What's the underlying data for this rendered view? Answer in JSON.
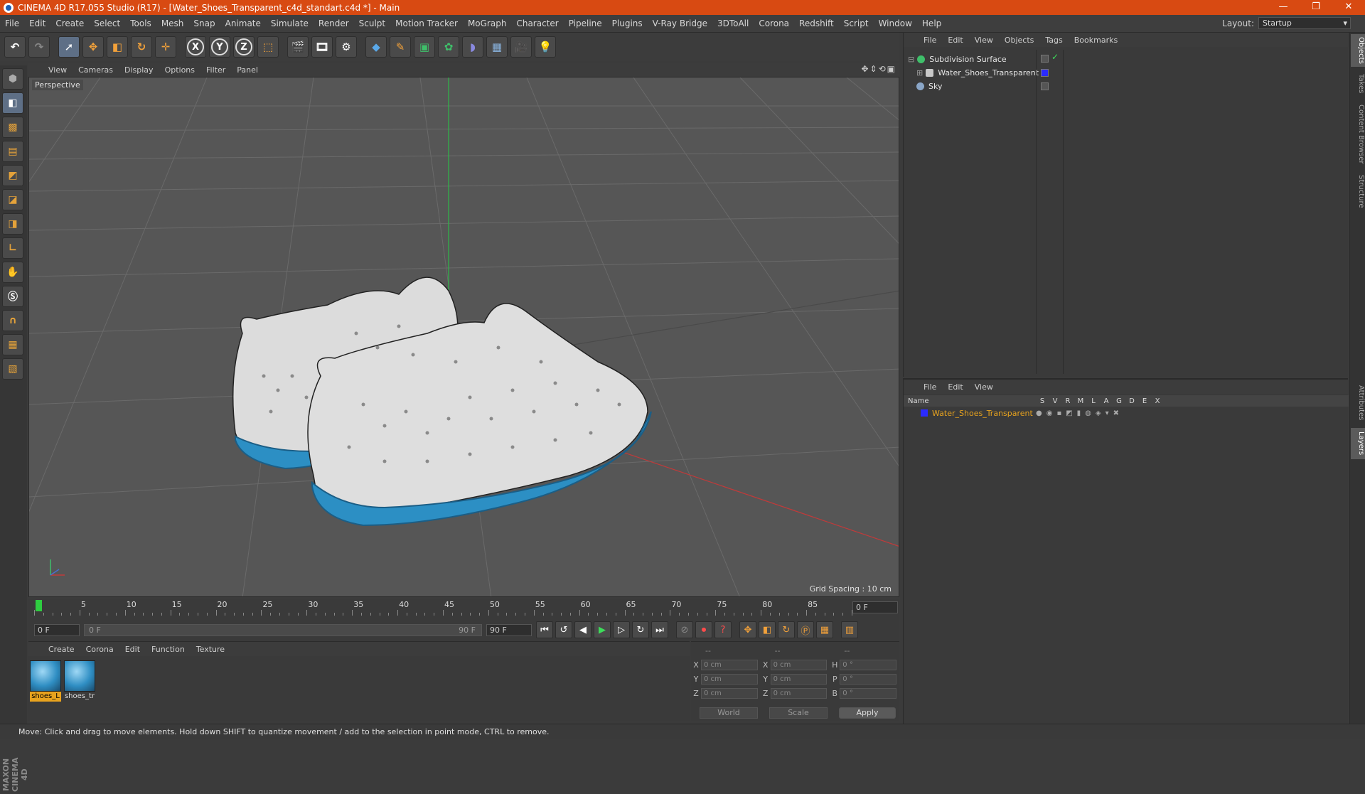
{
  "window": {
    "title": "CINEMA 4D R17.055 Studio (R17) - [Water_Shoes_Transparent_c4d_standart.c4d *] - Main",
    "minimize": "—",
    "restore": "❐",
    "close": "✕"
  },
  "menu": [
    "File",
    "Edit",
    "Create",
    "Select",
    "Tools",
    "Mesh",
    "Snap",
    "Animate",
    "Simulate",
    "Render",
    "Sculpt",
    "Motion Tracker",
    "MoGraph",
    "Character",
    "Pipeline",
    "Plugins",
    "V-Ray Bridge",
    "3DToAll",
    "Corona",
    "Redshift",
    "Script",
    "Window",
    "Help"
  ],
  "layout": {
    "label": "Layout:",
    "value": "Startup"
  },
  "toolbar_axes": [
    "X",
    "Y",
    "Z"
  ],
  "viewport": {
    "menu": [
      "View",
      "Cameras",
      "Display",
      "Options",
      "Filter",
      "Panel"
    ],
    "label": "Perspective",
    "grid_spacing": "Grid Spacing : 10 cm"
  },
  "timeline": {
    "ticks": [
      "0",
      "5",
      "10",
      "15",
      "20",
      "25",
      "30",
      "35",
      "40",
      "45",
      "50",
      "55",
      "60",
      "65",
      "70",
      "75",
      "80",
      "85",
      "90"
    ],
    "current_frame": "0 F",
    "start": "0 F",
    "range_start": "0 F",
    "range_end": "90 F",
    "end": "90 F"
  },
  "materials": {
    "menu": [
      "Create",
      "Corona",
      "Edit",
      "Function",
      "Texture"
    ],
    "items": [
      {
        "name": "shoes_L"
      },
      {
        "name": "shoes_tr"
      }
    ]
  },
  "coords": {
    "headers": [
      "--",
      "--",
      "--"
    ],
    "rows": [
      {
        "a": "X",
        "av": "0 cm",
        "b": "X",
        "bv": "0 cm",
        "c": "H",
        "cv": "0 °"
      },
      {
        "a": "Y",
        "av": "0 cm",
        "b": "Y",
        "bv": "0 cm",
        "c": "P",
        "cv": "0 °"
      },
      {
        "a": "Z",
        "av": "0 cm",
        "b": "Z",
        "bv": "0 cm",
        "c": "B",
        "cv": "0 °"
      }
    ],
    "world": "World",
    "scale": "Scale",
    "apply": "Apply"
  },
  "objects": {
    "menu": [
      "File",
      "Edit",
      "View",
      "Objects",
      "Tags",
      "Bookmarks"
    ],
    "items": [
      {
        "name": "Subdivision Surface",
        "color": "#3fbf6a"
      },
      {
        "name": "Water_Shoes_Transparent",
        "color": "#c8c8c8"
      },
      {
        "name": "Sky",
        "color": "#8aa6c8"
      }
    ]
  },
  "layers": {
    "menu": [
      "File",
      "Edit",
      "View"
    ],
    "columns": [
      "Name",
      "S",
      "V",
      "R",
      "M",
      "L",
      "A",
      "G",
      "D",
      "E",
      "X"
    ],
    "row": {
      "name": "Water_Shoes_Transparent",
      "color": "#2b2bff"
    }
  },
  "right_tabs": [
    "Objects",
    "Takes",
    "Content Browser",
    "Structure",
    "Attributes",
    "Layers"
  ],
  "status": "Move: Click and drag to move elements. Hold down SHIFT to quantize movement / add to the selection in point mode, CTRL to remove.",
  "branding": "MAXON CINEMA 4D",
  "colors": {
    "title_bar": "#d84a12",
    "sole_blue": "#2c8fc4",
    "shoe_white": "#dcdcdc",
    "selected": "#e8a31e"
  }
}
